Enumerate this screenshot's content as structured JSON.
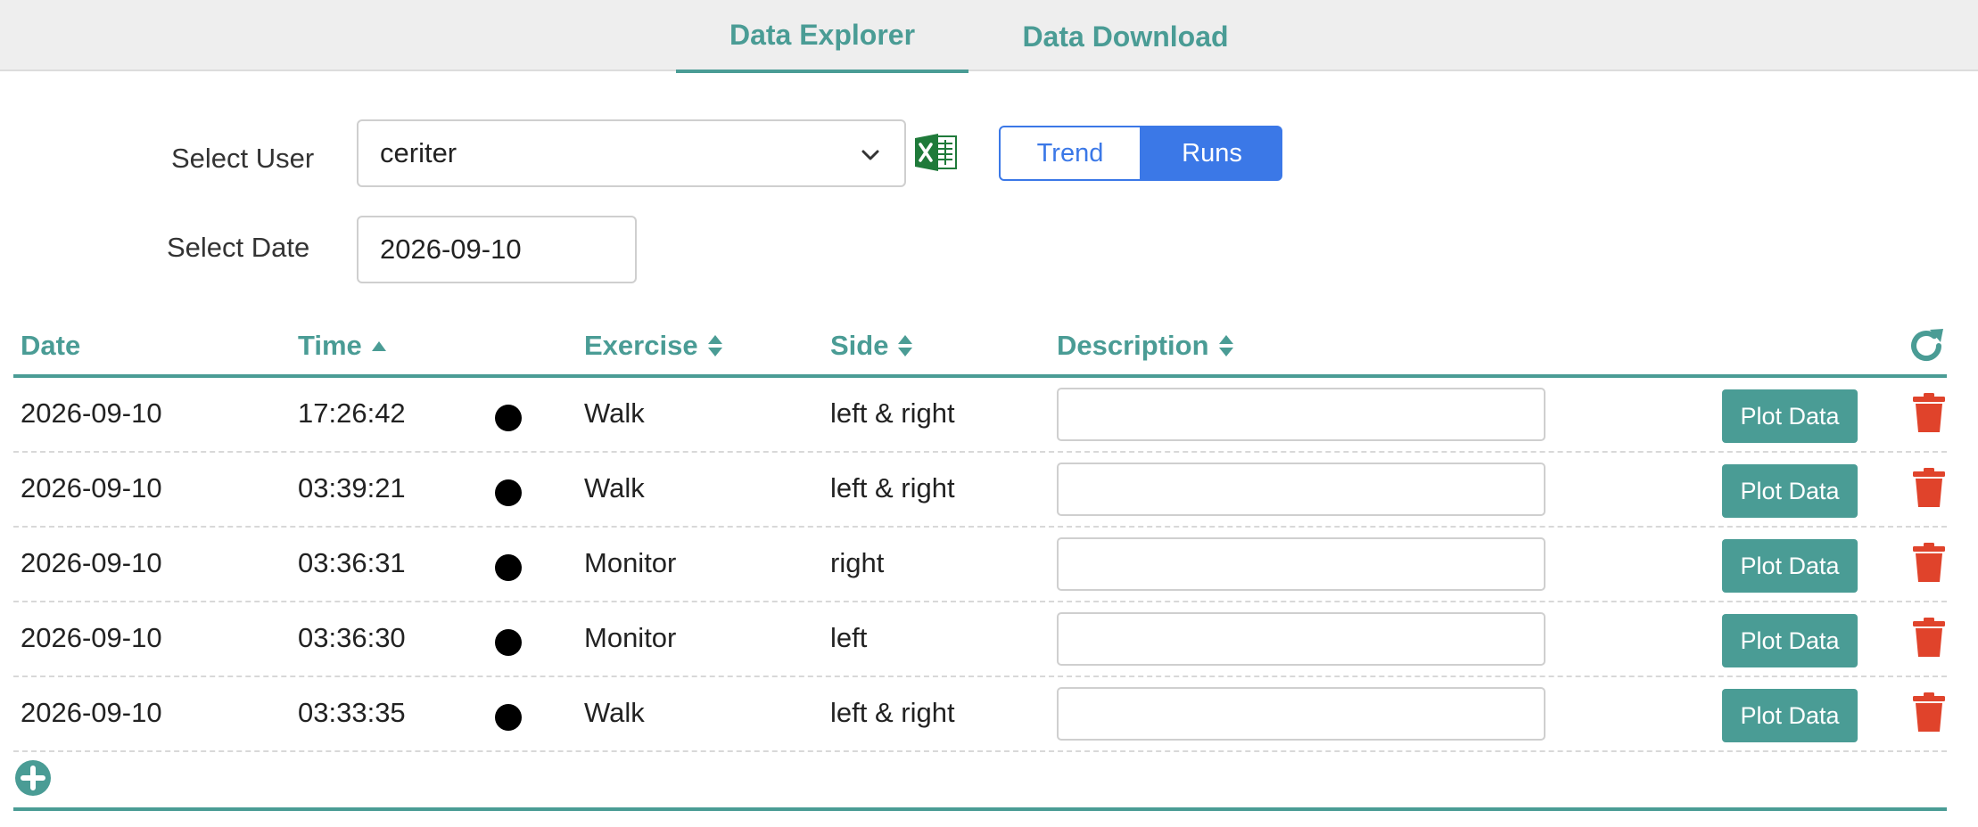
{
  "tabs": [
    {
      "label": "Data Explorer",
      "active": true
    },
    {
      "label": "Data Download",
      "active": false
    }
  ],
  "form": {
    "select_user_label": "Select User",
    "user_value": "ceriter",
    "select_date_label": "Select Date",
    "date_value": "2026-09-10",
    "view_toggle": {
      "trend_label": "Trend",
      "runs_label": "Runs",
      "selected": "Runs"
    }
  },
  "table": {
    "columns": [
      "Date",
      "Time",
      "Exercise",
      "Side",
      "Description"
    ],
    "sort": {
      "Time": "ascending",
      "Exercise": "sortable",
      "Side": "sortable",
      "Description": "sortable"
    },
    "plot_label": "Plot Data",
    "rows": [
      {
        "date": "2026-09-10",
        "time": "17:26:42",
        "exercise": "Walk",
        "side": "left & right",
        "description": ""
      },
      {
        "date": "2026-09-10",
        "time": "03:39:21",
        "exercise": "Walk",
        "side": "left & right",
        "description": ""
      },
      {
        "date": "2026-09-10",
        "time": "03:36:31",
        "exercise": "Monitor",
        "side": "right",
        "description": ""
      },
      {
        "date": "2026-09-10",
        "time": "03:36:30",
        "exercise": "Monitor",
        "side": "left",
        "description": ""
      },
      {
        "date": "2026-09-10",
        "time": "03:33:35",
        "exercise": "Walk",
        "side": "left & right",
        "description": ""
      }
    ]
  },
  "icons": {
    "excel": "excel-icon",
    "refresh": "refresh-icon",
    "delete": "trash-icon",
    "add": "plus-circle-icon",
    "status": "status-dot-icon",
    "dropdown": "chevron-down-icon"
  },
  "colors": {
    "accent": "#4a9c95",
    "primary": "#3b78e7",
    "danger": "#e0432b",
    "excel": "#1f7a3a"
  }
}
